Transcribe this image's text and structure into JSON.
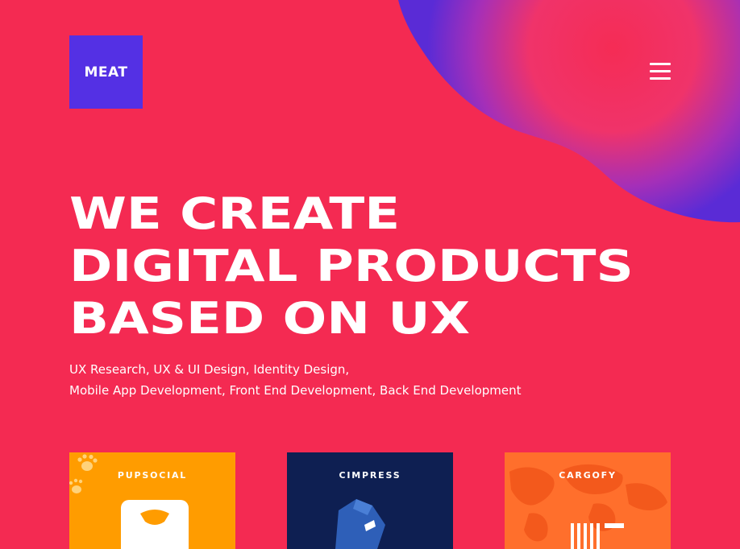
{
  "header": {
    "logo_text": "MEAT",
    "menu_icon": "hamburger-menu-icon"
  },
  "hero": {
    "headline_lines": [
      "WE CREATE",
      "DIGITAL PRODUCTS",
      "BASED ON UX"
    ],
    "services_lines": [
      "UX Research, UX & UI Design, Identity Design,",
      "Mobile App Development, Front End Development, Back End Development"
    ]
  },
  "projects": [
    {
      "title": "PUPSOCIAL",
      "icon": "paw-icon"
    },
    {
      "title": "CIMPRESS",
      "icon": "shoe-icon"
    },
    {
      "title": "CARGOFY",
      "icon": "world-map-icon"
    }
  ],
  "colors": {
    "background": "#f42a52",
    "logo_bg": "#5430e4",
    "blob_purple": "#5a2bd6",
    "pupsocial_bg": "#ff9c00",
    "cimpress_bg": "#0e1f52",
    "cargofy_bg": "#ff6f2c"
  }
}
